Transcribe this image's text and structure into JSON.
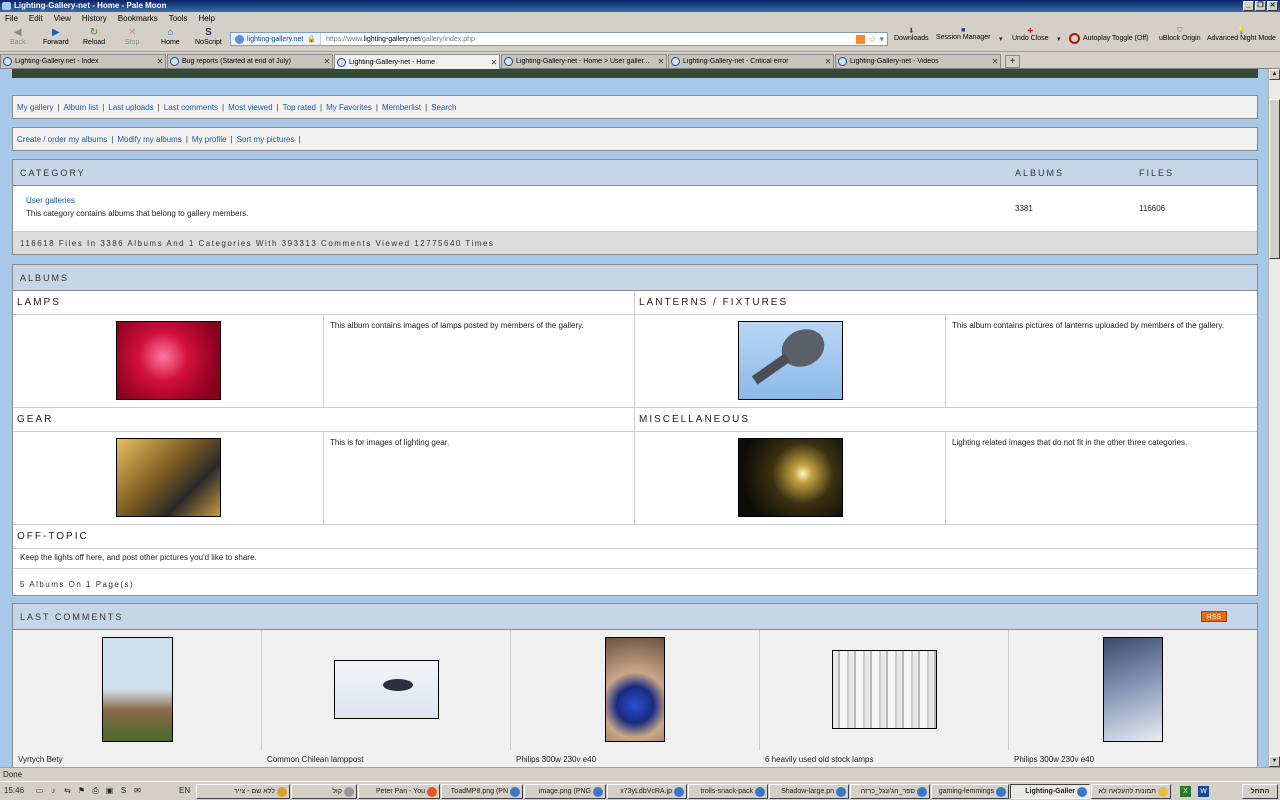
{
  "window": {
    "title": "Lighting-Gallery-net - Home - Pale Moon"
  },
  "menu": [
    "File",
    "Edit",
    "View",
    "History",
    "Bookmarks",
    "Tools",
    "Help"
  ],
  "toolbar": {
    "back": "Back",
    "forward": "Forward",
    "reload": "Reload",
    "stop": "Stop",
    "home": "Home",
    "noscript": "NoScript",
    "identity": "lighting-gallery.net",
    "url_prefix": "https://www.",
    "url_host": "lighting-gallery.net",
    "url_path": "/gallery/index.php",
    "downloads": "Downloads",
    "session_manager": "Session Manager",
    "undo_close": "Undo Close",
    "autoplay": "Autoplay Toggle (Off)",
    "ublock": "uBlock Origin",
    "night_mode": "Advanced Night Mode"
  },
  "tabs": [
    "Lighting-Gallery.net - Index",
    "Bug reports (Started at end of July)",
    "Lighting-Gallery-net - Home",
    "Lighting-Gallery-net - Home > User galler...",
    "Lighting-Gallery-net - Critical error",
    "Lighting-Gallery-net - Videos"
  ],
  "nav1": [
    "My gallery",
    "Album list",
    "Last uploads",
    "Last comments",
    "Most viewed",
    "Top rated",
    "My Favorites",
    "Memberlist",
    "Search"
  ],
  "nav2": [
    "Create / order my albums",
    "Modify my albums",
    "My profile",
    "Sort my pictures"
  ],
  "categories": {
    "head_category": "CATEGORY",
    "head_albums": "ALBUMS",
    "head_files": "FILES",
    "row": {
      "name": "User galleries",
      "desc": "This category contains albums that belong to gallery members.",
      "albums": "3381",
      "files": "116606"
    },
    "footer": "116618 Files In 3386 Albums And 1 Categories With 393313 Comments Viewed 12775640 Times"
  },
  "albums": {
    "head": "ALBUMS",
    "items": [
      {
        "title": "LAMPS",
        "desc": "This album contains images of lamps posted by members of the gallery."
      },
      {
        "title": "LANTERNS / FIXTURES",
        "desc": "This album contains pictures of lanterns uploaded by members of the gallery."
      },
      {
        "title": "GEAR",
        "desc": "This is for images of lighting gear."
      },
      {
        "title": "MISCELLANEOUS",
        "desc": "Lighting related images that do not fit in the other three categories."
      },
      {
        "title": "OFF-TOPIC",
        "desc": "Keep the lights off here, and post other pictures you'd like to share."
      }
    ],
    "footer": "5 Albums On 1 Page(s)"
  },
  "comments": {
    "head": "LAST COMMENTS",
    "rss": "RSS",
    "items": [
      "Vyrtych Bety",
      "Common Chilean lamppost",
      "Philips 300w 230v e40",
      "6 heavily used old stock lamps",
      "Philips 300w 230v e40"
    ]
  },
  "status": "Done",
  "taskbar": {
    "clock": "15:46",
    "lang": "EN",
    "items": [
      "ללא שם - צייר",
      "קול",
      "Peter Pan - You",
      "ToadMP8.png (PN",
      "image.png (PNG",
      "x73yLdbVcRA.jp",
      "trolls-snack-pack",
      "Shadow-large.pn",
      "ספר_הג'ונגל_כרזה",
      "gaming-lemmings",
      "Lighting-Galler",
      "תמונות להעלאה לא"
    ],
    "start": "התחל"
  }
}
